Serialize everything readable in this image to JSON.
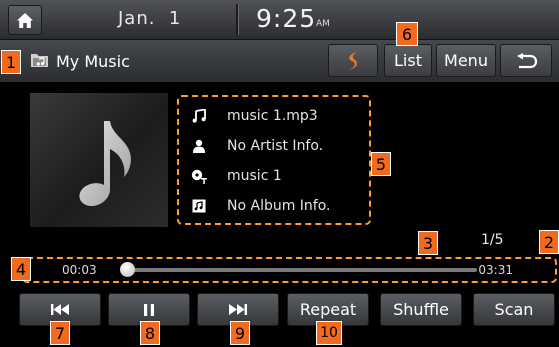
{
  "status": {
    "date": "Jan.  1",
    "time": "9:25",
    "ampm": "AM"
  },
  "titlebar": {
    "title": "My Music",
    "list_label": "List",
    "menu_label": "Menu"
  },
  "track": {
    "filename": "music 1.mp3",
    "artist": "No Artist Info.",
    "title": "music 1",
    "album": "No Album Info."
  },
  "playback": {
    "elapsed": "00:03",
    "total": "03:31",
    "counter": "1/5",
    "progress_fraction": 0.015
  },
  "controls": {
    "repeat_label": "Repeat",
    "shuffle_label": "Shuffle",
    "scan_label": "Scan"
  },
  "callouts": [
    "1",
    "2",
    "3",
    "4",
    "5",
    "6",
    "7",
    "8",
    "9",
    "10"
  ],
  "colors": {
    "callout": "#f26a1d",
    "dashed_outline": "#ff9d2e",
    "soundhound": "#f47b20"
  },
  "icons": [
    "home-icon",
    "music-folder-icon",
    "soundhound-icon",
    "back-arrow-icon",
    "note-icon",
    "artist-icon",
    "title-icon",
    "album-icon",
    "previous-track-icon",
    "pause-icon",
    "next-track-icon"
  ]
}
